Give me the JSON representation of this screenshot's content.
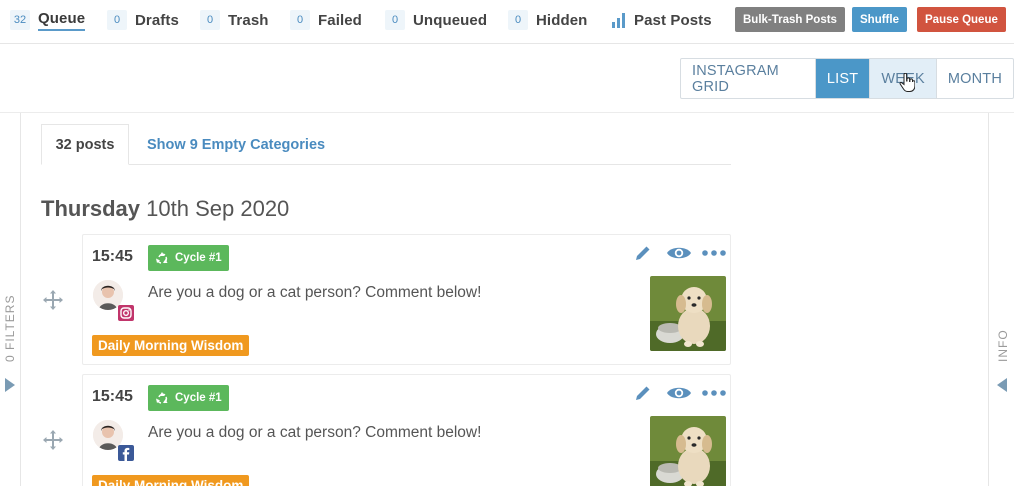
{
  "tabs": [
    {
      "count": "32",
      "label": "Queue"
    },
    {
      "count": "0",
      "label": "Drafts"
    },
    {
      "count": "0",
      "label": "Trash"
    },
    {
      "count": "0",
      "label": "Failed"
    },
    {
      "count": "0",
      "label": "Unqueued"
    },
    {
      "count": "0",
      "label": "Hidden"
    }
  ],
  "past_posts_label": "Past Posts",
  "buttons": {
    "bulk_trash": "Bulk-Trash Posts",
    "shuffle": "Shuffle",
    "pause": "Pause Queue"
  },
  "views": {
    "grid": "INSTAGRAM GRID",
    "list": "LIST",
    "week": "WEEK",
    "month": "MONTH",
    "selected": "LIST"
  },
  "content_tabs": {
    "posts": "32 posts",
    "empty": "Show 9 Empty Categories"
  },
  "rails": {
    "left": "0 FILTERS",
    "right": "INFO"
  },
  "date": {
    "day": "Thursday",
    "rest": "10th Sep 2020"
  },
  "posts": [
    {
      "time": "15:45",
      "cycle": "Cycle #1",
      "caption": "Are you a dog or a cat person? Comment below!",
      "network": "instagram-icon",
      "category": "Daily Morning Wisdom"
    },
    {
      "time": "15:45",
      "cycle": "Cycle #1",
      "caption": "Are you a dog or a cat person? Comment below!",
      "network": "facebook-icon",
      "category": "Daily Morning Wisdom"
    }
  ],
  "colors": {
    "accent": "#4b97c8",
    "green": "#5cb85c",
    "orange": "#f0991f",
    "red": "#d1543f",
    "grey": "#808080"
  }
}
